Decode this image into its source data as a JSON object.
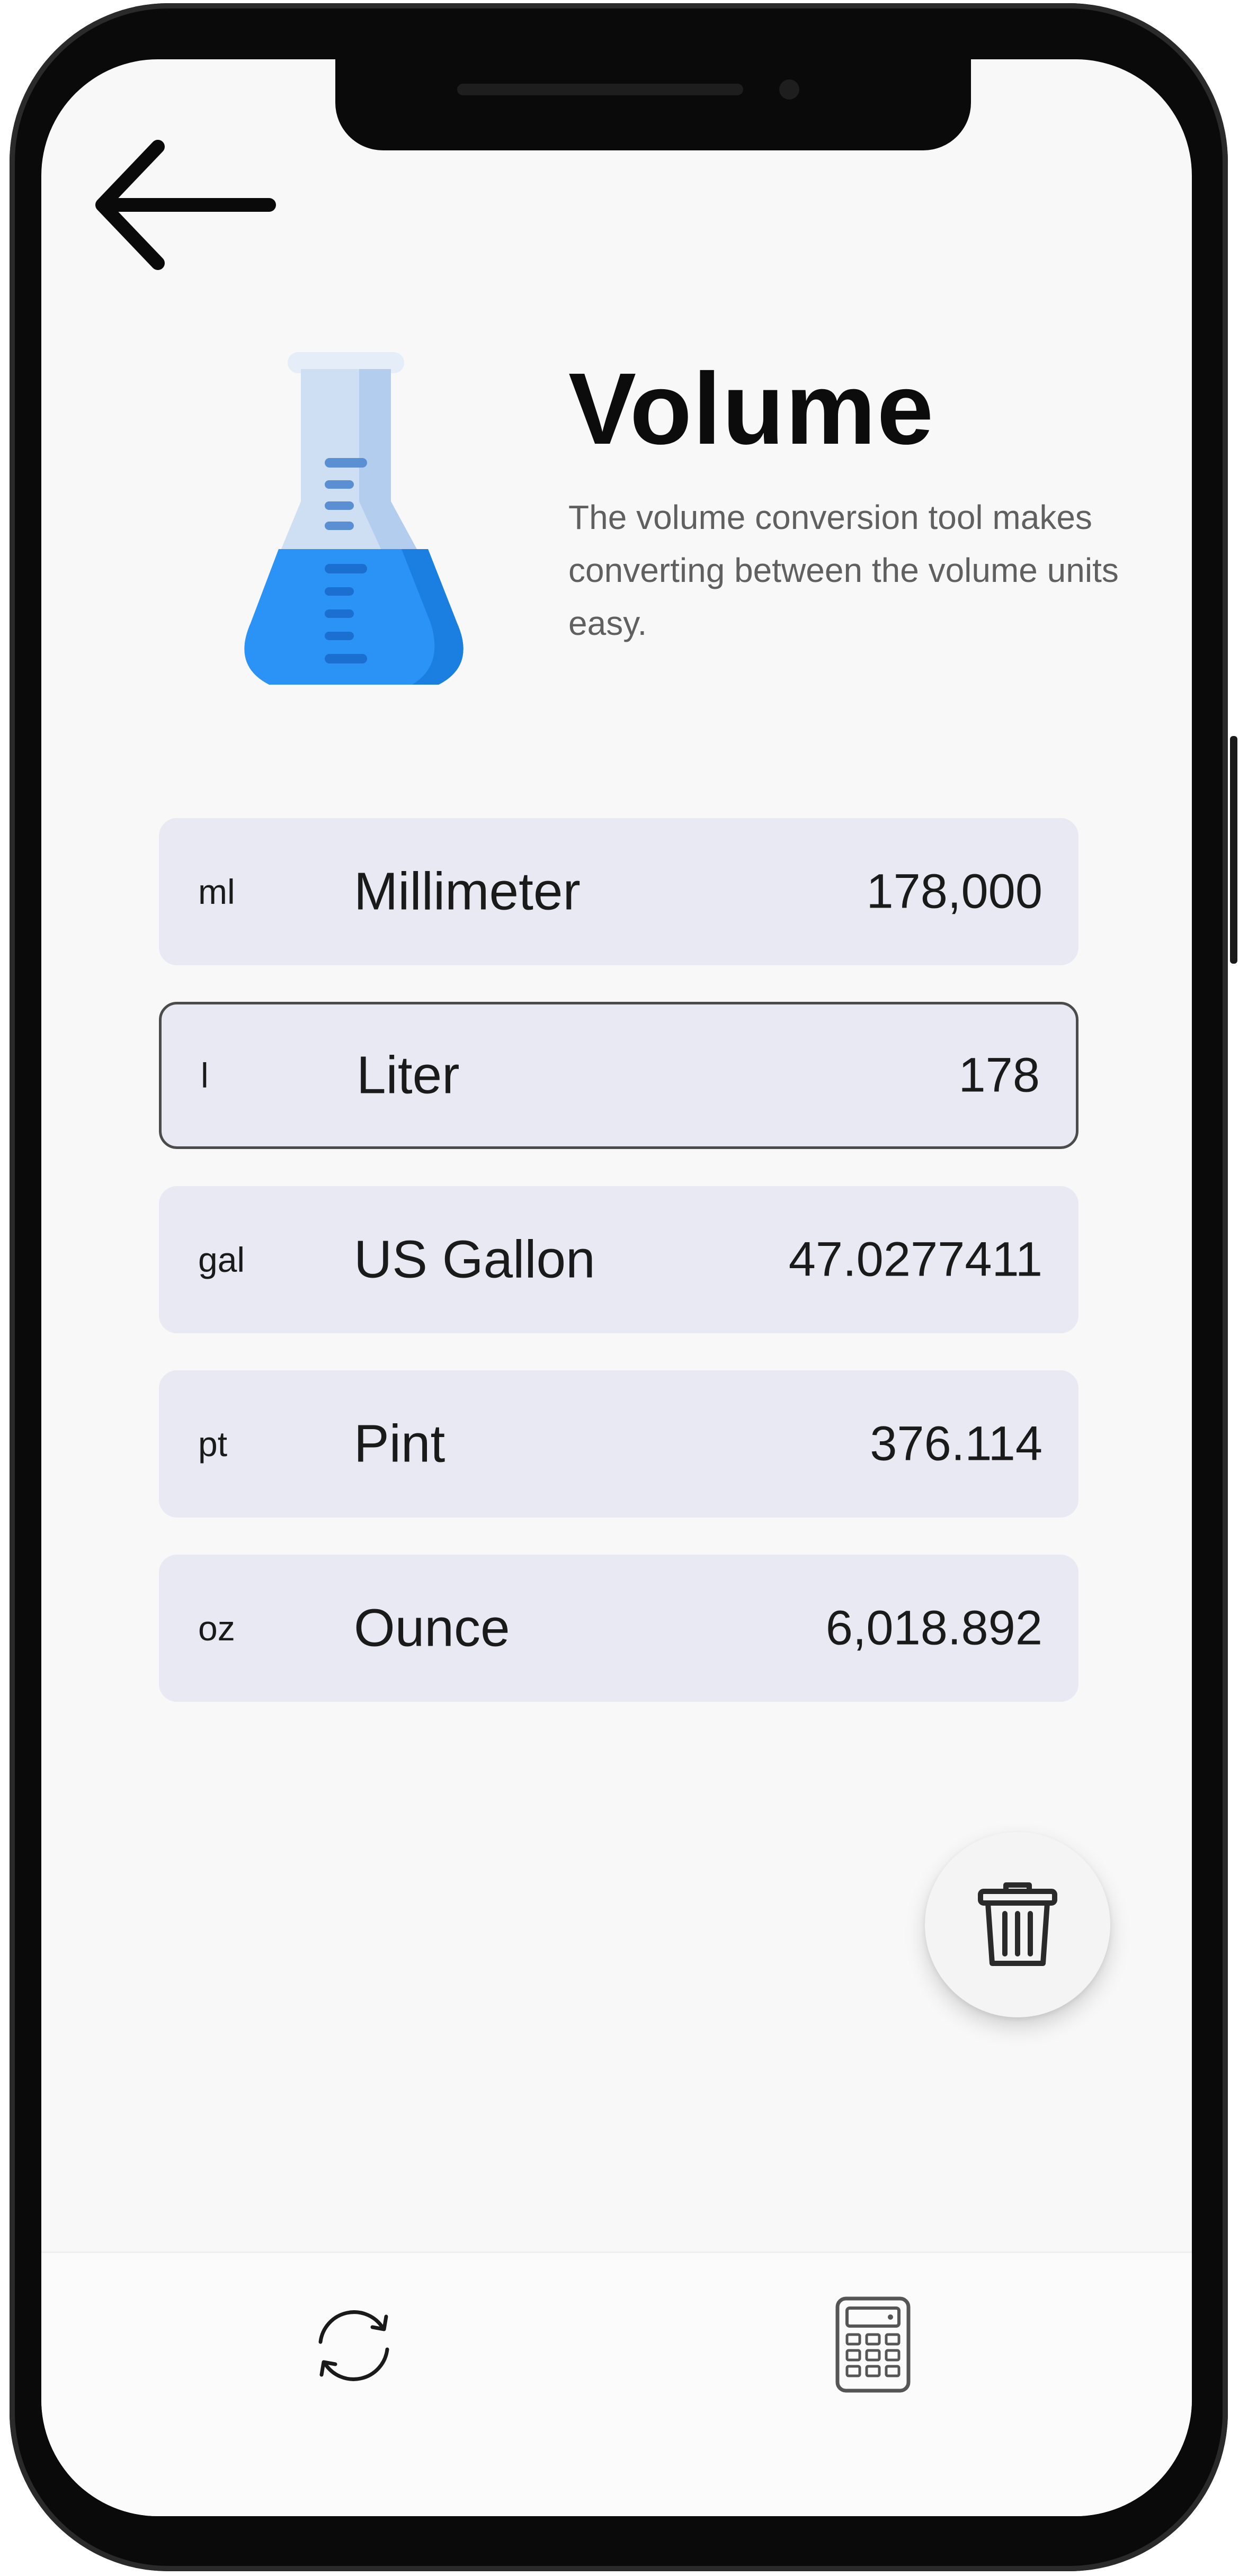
{
  "header": {
    "back_icon": "arrow-left-icon",
    "illustration_icon": "flask-icon"
  },
  "info": {
    "title": "Volume",
    "description": "The volume conversion tool makes converting between the volume units easy."
  },
  "units": [
    {
      "abbr": "ml",
      "name": "Millimeter",
      "value": "178,000",
      "selected": false
    },
    {
      "abbr": "l",
      "name": "Liter",
      "value": "178",
      "selected": true
    },
    {
      "abbr": "gal",
      "name": "US Gallon",
      "value": "47.0277411",
      "selected": false
    },
    {
      "abbr": "pt",
      "name": "Pint",
      "value": "376.114",
      "selected": false
    },
    {
      "abbr": "oz",
      "name": "Ounce",
      "value": "6,018.892",
      "selected": false
    }
  ],
  "actions": {
    "delete_icon": "trash-icon"
  },
  "bottom_nav": {
    "items": [
      {
        "icon": "refresh-icon"
      },
      {
        "icon": "calculator-icon"
      }
    ]
  },
  "colors": {
    "screen_bg": "#f8f8f8",
    "row_bg": "#e8e9f2",
    "selected_border": "#4b4b4b",
    "flask_liquid": "#2b93f5",
    "flask_glass": "#cfdff3"
  }
}
